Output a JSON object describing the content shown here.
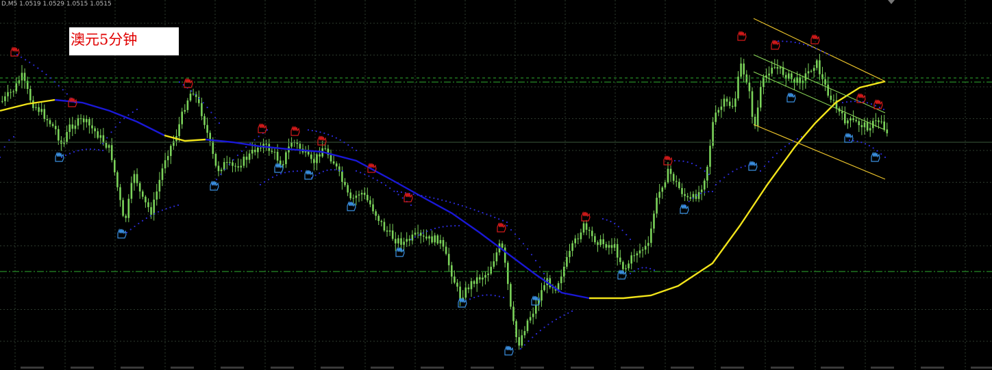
{
  "header": {
    "symbol_tf": "D,M5",
    "ohlc": "1.0519 1.0529 1.0515 1.0515"
  },
  "label": {
    "text": "澳元5分钟"
  },
  "colors": {
    "background": "#000000",
    "grid": "#2e3b2e",
    "candle": "#7bd35a",
    "ma_fast_up": "#f2e41a",
    "ma_fast_down": "#1a18d6",
    "sar_dots": "#2b2bd8",
    "fractal_up": "#d41a1a",
    "fractal_down": "#3a8fe0",
    "channel": "#e8c12a",
    "channel_mid": "#8edc5a",
    "level_line": "#2fae2f"
  },
  "chart_data": {
    "type": "candlestick",
    "title": "澳元5分钟",
    "indicators": [
      "moving-average",
      "parabolic-sar",
      "fractals",
      "regression-channel",
      "horizontal-levels"
    ],
    "price_levels": [
      "upper-resistance-1",
      "upper-resistance-2",
      "lower-support"
    ],
    "grid": true,
    "fractal_icons": {
      "up": "red-hand-icon",
      "down": "blue-hand-icon"
    }
  }
}
